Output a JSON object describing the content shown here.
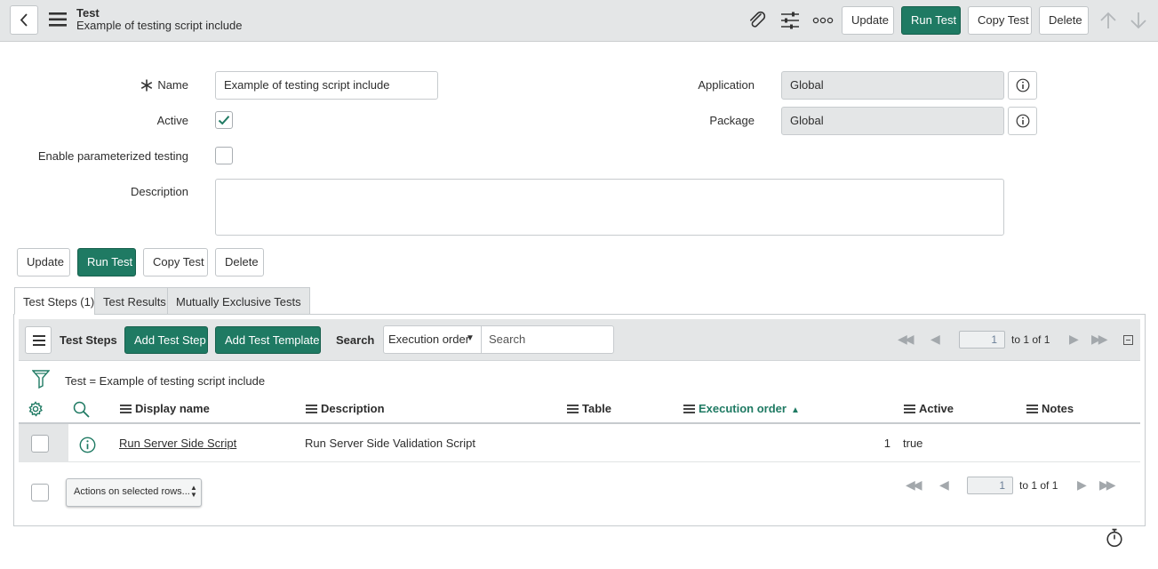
{
  "header": {
    "title": "Test",
    "subtitle": "Example of testing script include",
    "buttons": {
      "update": "Update",
      "run_test": "Run Test",
      "copy_test": "Copy Test",
      "delete": "Delete"
    },
    "icons": [
      "back-icon",
      "menu-icon",
      "attachment-icon",
      "settings-sliders-icon",
      "more-icon",
      "arrow-up-icon",
      "arrow-down-icon"
    ]
  },
  "form": {
    "name_label": "Name",
    "name_value": "Example of testing script include",
    "active_label": "Active",
    "active_checked": true,
    "param_label": "Enable parameterized testing",
    "param_checked": false,
    "description_label": "Description",
    "description_value": "",
    "application_label": "Application",
    "application_value": "Global",
    "package_label": "Package",
    "package_value": "Global"
  },
  "form_buttons": {
    "update": "Update",
    "run_test": "Run Test",
    "copy_test": "Copy Test",
    "delete": "Delete"
  },
  "tabs": [
    {
      "label": "Test Steps (1)",
      "active": true
    },
    {
      "label": "Test Results",
      "active": false
    },
    {
      "label": "Mutually Exclusive Tests",
      "active": false
    }
  ],
  "related_list": {
    "title": "Test Steps",
    "add_step": "Add Test Step",
    "add_template": "Add Test Template",
    "search_label": "Search",
    "search_field": "Execution order",
    "search_placeholder": "Search",
    "page_value": "1",
    "page_of": "to 1 of 1",
    "filter_text": "Test = Example of testing script include",
    "columns": [
      "Display name",
      "Description",
      "Table",
      "Execution order",
      "Active",
      "Notes"
    ],
    "sorted_column": "Execution order",
    "rows": [
      {
        "display_name": "Run Server Side Script",
        "description": "Run Server Side Validation Script",
        "table": "",
        "execution_order": "1",
        "active": "true",
        "notes": ""
      }
    ],
    "actions_select": "Actions on selected rows...",
    "footer_page_value": "1",
    "footer_page_of": "to 1 of 1"
  },
  "colors": {
    "primary": "#1f7a63",
    "header_bg": "#e4e6e7",
    "border": "#c7cbce"
  }
}
